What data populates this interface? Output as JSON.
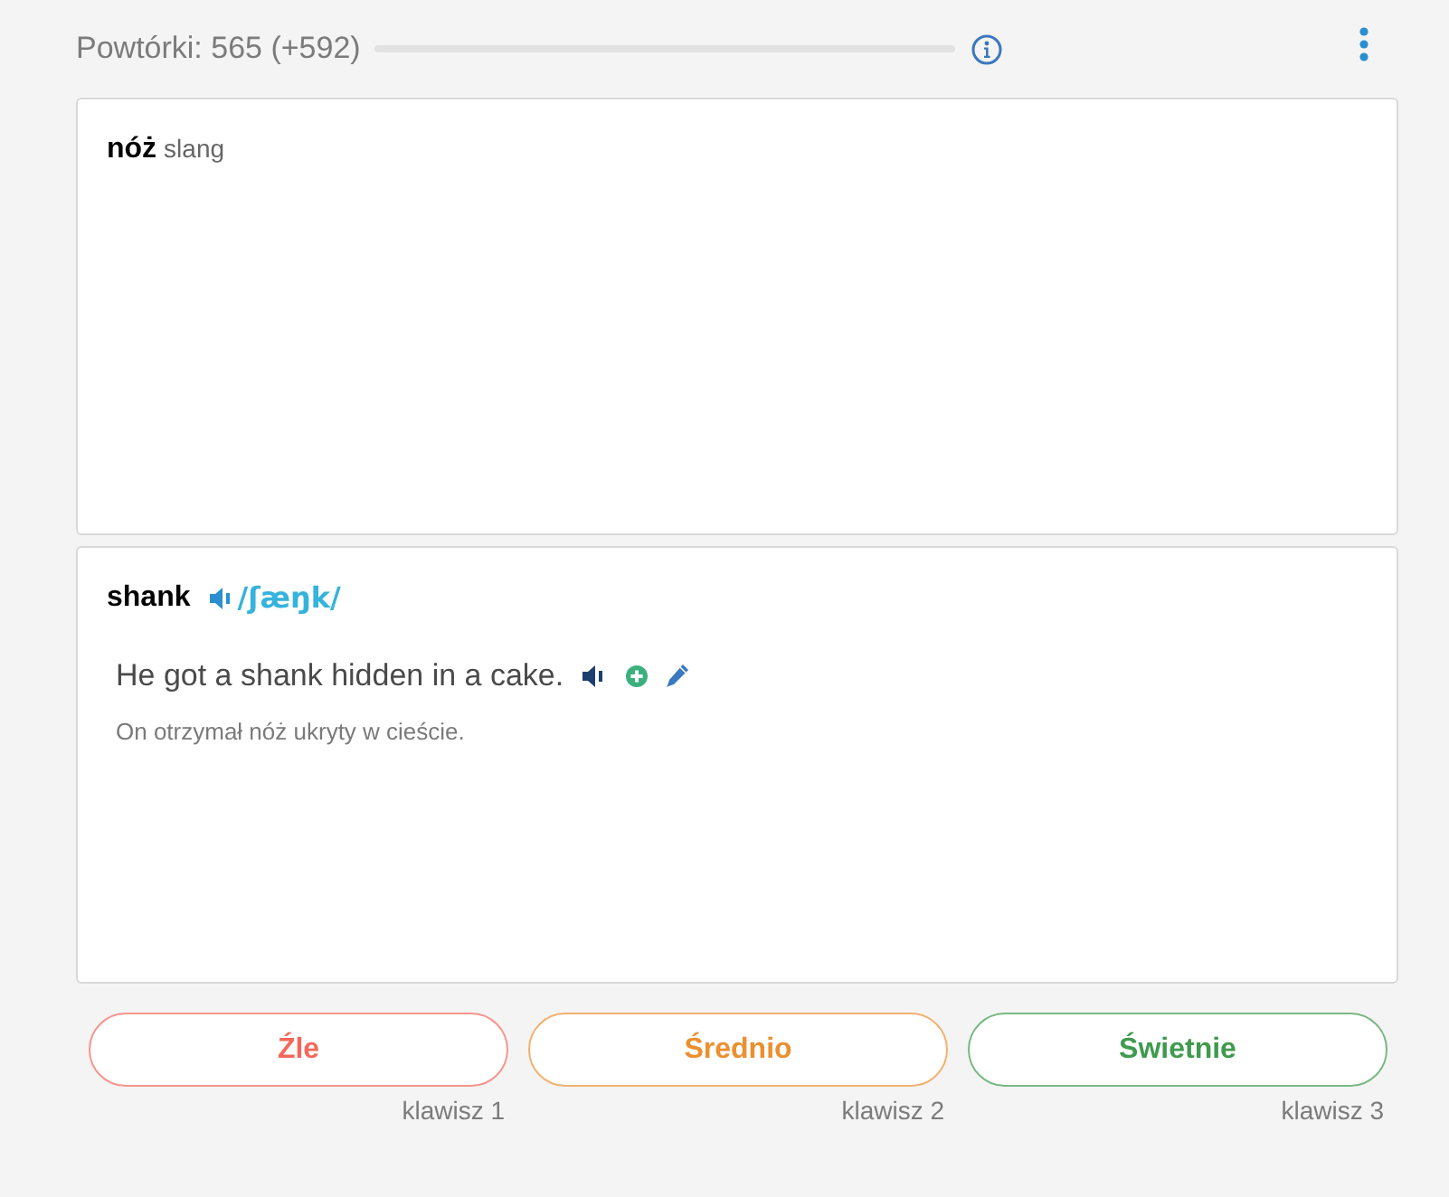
{
  "header": {
    "reviews_label": "Powtórki: 565 (+592)",
    "progress": {
      "level": 0
    }
  },
  "question_card": {
    "word": "nóż",
    "note": "slang"
  },
  "answer_card": {
    "word": "shank",
    "phonetic": "/ʃæŋk/",
    "examples": [
      {
        "sentence": "He got a shank hidden in a cake.",
        "translation": "On otrzymał nóż ukryty w cieście."
      }
    ]
  },
  "grade_buttons": [
    {
      "label": "Źle",
      "color": "#f4675a",
      "key_hint": "klawisz 1"
    },
    {
      "label": "Średnio",
      "color": "#ec8f30",
      "key_hint": "klawisz 2"
    },
    {
      "label": "Świetnie",
      "color": "#3f9a4e",
      "key_hint": "klawisz 3"
    }
  ]
}
